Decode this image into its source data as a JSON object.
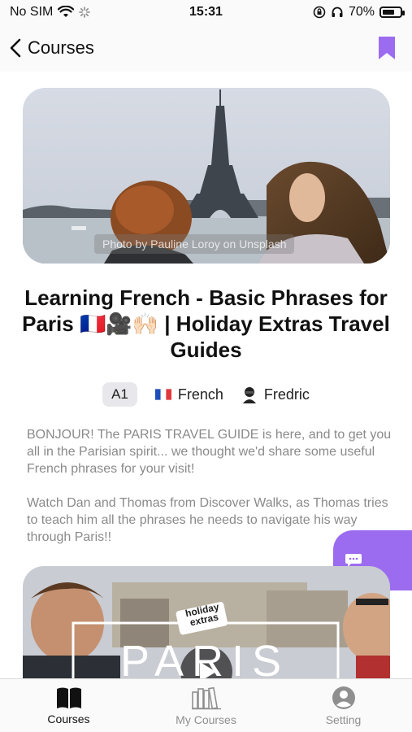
{
  "status_bar": {
    "carrier": "No SIM",
    "time": "15:31",
    "battery_percent": "70%",
    "battery_level": 0.7
  },
  "nav": {
    "back_label": "Courses",
    "bookmark_icon": "bookmark-icon",
    "accent": "#9b6cf0"
  },
  "course": {
    "photo_credit": "Photo by Pauline Loroy on Unsplash",
    "title": "Learning French - Basic Phrases for Paris 🇫🇷🎥🙌🏻 | Holiday Extras Travel Guides",
    "level": "A1",
    "language": "French",
    "author": "Fredric",
    "description_1": "BONJOUR! The PARIS TRAVEL GUIDE is here, and to get you all in the Parisian spirit... we thought we'd share some useful French phrases for your visit!",
    "description_2": "Watch Dan and Thomas from Discover Walks, as Thomas tries to teach him all the phrases he needs to navigate his way through Paris!!",
    "video_title_text": "PARIS",
    "video_logo_text": "holiday extras"
  },
  "tabs": [
    {
      "label": "Courses",
      "icon": "book-icon",
      "active": true
    },
    {
      "label": "My Courses",
      "icon": "library-icon",
      "active": false
    },
    {
      "label": "Setting",
      "icon": "user-icon",
      "active": false
    }
  ]
}
